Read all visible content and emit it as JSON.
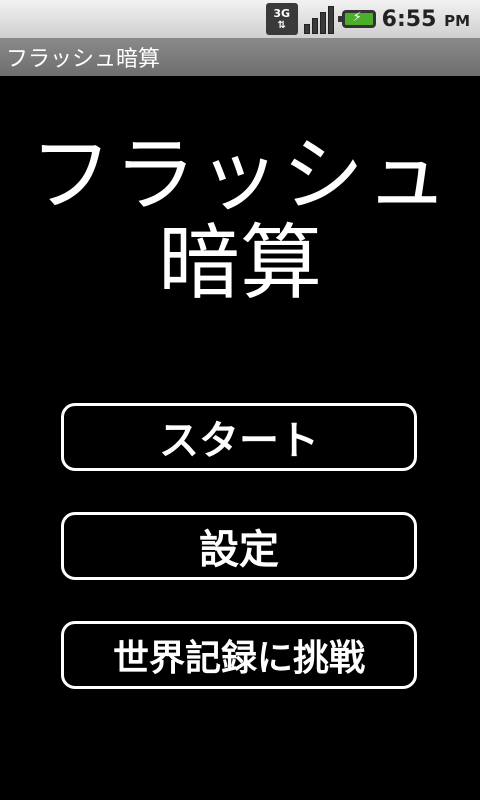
{
  "status_bar": {
    "network_label": "3G",
    "network_arrows": "⇅",
    "time": "6:55",
    "ampm": "PM",
    "battery_color": "#4caf2a"
  },
  "app": {
    "title": "フラッシュ暗算"
  },
  "heading": {
    "line1": "フラッシュ",
    "line2": "暗算"
  },
  "buttons": {
    "start_label": "スタート",
    "settings_label": "設定",
    "record_label": "世界記録に挑戦"
  }
}
